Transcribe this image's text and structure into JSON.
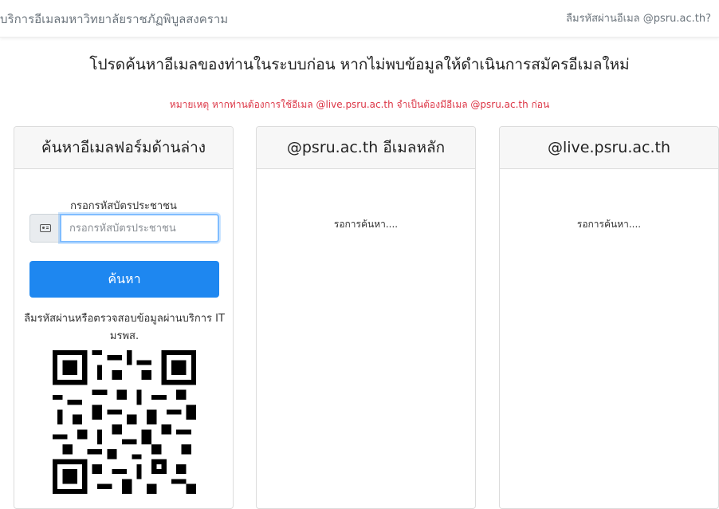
{
  "header": {
    "brand": "บริการอีเมลมหาวิทยาลัยราชภัฏพิบูลสงคราม",
    "forgot_link": "ลืมรหัสผ่านอีเมล @psru.ac.th?"
  },
  "page": {
    "heading": "โปรดค้นหาอีเมลของท่านในระบบก่อน หากไม่พบข้อมูลให้ดำเนินการสมัครอีเมลใหม่",
    "note": "หมายเหตุ หากท่านต้องการใช้อีเมล @live.psru.ac.th จำเป็นต้องมีอีเมล @psru.ac.th ก่อน"
  },
  "search_card": {
    "title": "ค้นหาอีเมลฟอร์มด้านล่าง",
    "field_label": "กรอกรหัสบัตรประชาชน",
    "input_placeholder": "กรอกรหัสบัตรประชาชน",
    "input_value": "",
    "prefix_icon": "id-card-icon",
    "button_label": "ค้นหา",
    "help_text": "ลืมรหัสผ่านหรือตรวจสอบข้อมูลผ่านบริการ IT มรพส.",
    "qr_icon": "qr-code"
  },
  "psru_card": {
    "title": "@psru.ac.th อีเมลหลัก",
    "status": "รอการค้นหา...."
  },
  "live_card": {
    "title": "@live.psru.ac.th",
    "status": "รอการค้นหา...."
  },
  "colors": {
    "primary_button": "#1e87f0",
    "note_red": "#dc3545",
    "header_bg": "#f7f7f7"
  }
}
